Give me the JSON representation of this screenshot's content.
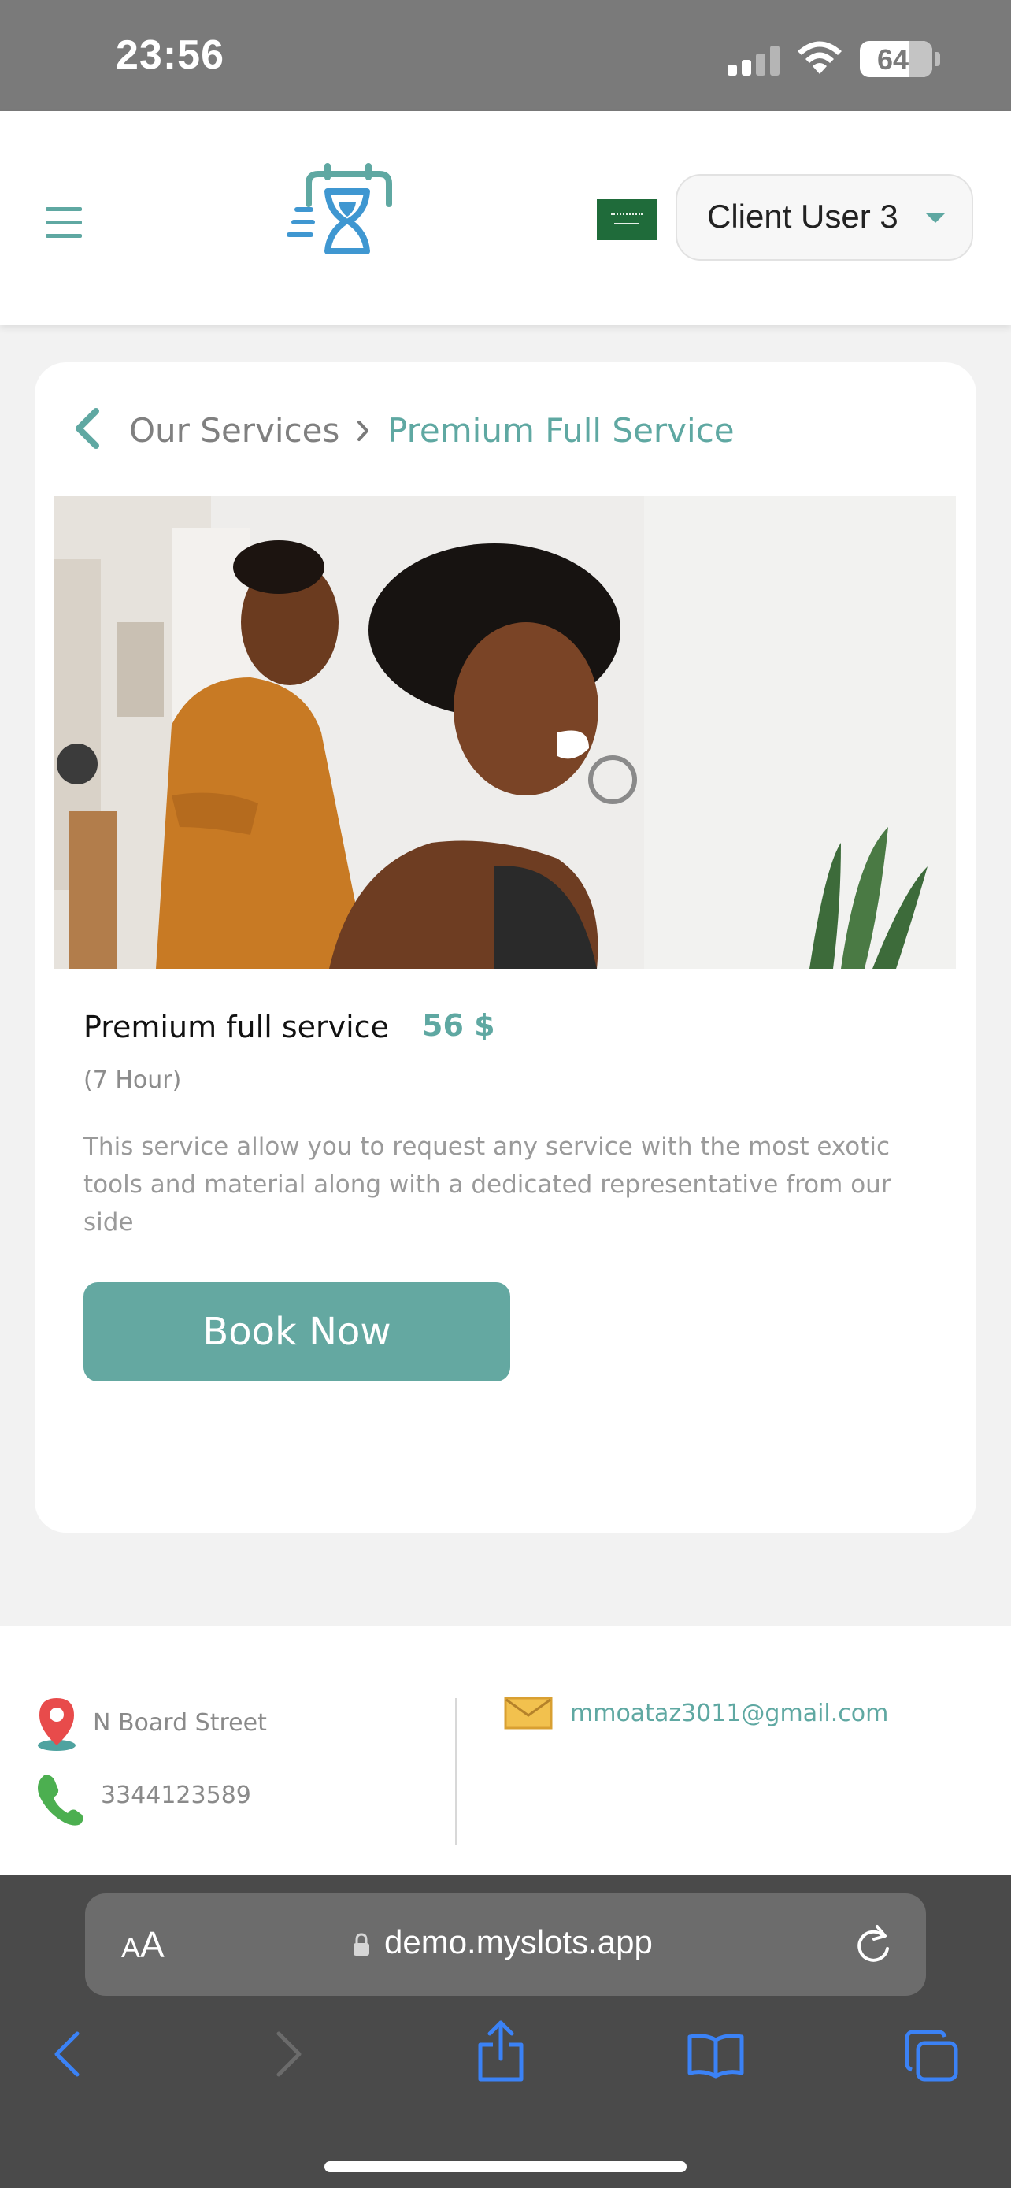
{
  "status_bar": {
    "time": "23:56",
    "battery": "64",
    "icons": [
      "signal-icon",
      "wifi-icon",
      "battery-icon"
    ]
  },
  "header": {
    "menu_icon": "hamburger-icon",
    "logo_icon": "calendar-hourglass-logo",
    "flag_icon": "saudi-flag-icon",
    "user_label": "Client User 3"
  },
  "breadcrumb": {
    "back_icon": "chevron-left-icon",
    "parent": "Our Services",
    "separator_icon": "chevron-right-icon",
    "current": "Premium Full Service"
  },
  "service": {
    "image": "stylist-doing-hair-photo",
    "title": "Premium full service",
    "price": "56 $",
    "duration": "(7 Hour)",
    "description": "This service allow you to request any service with the most exotic tools and material along with a dedicated representative from our side",
    "cta": "Book Now"
  },
  "footer": {
    "address": "N Board Street",
    "phone": "3344123589",
    "email": "mmoataz3011@gmail.com"
  },
  "browser": {
    "text_size_small": "A",
    "text_size_big": "A",
    "url": "demo.myslots.app",
    "toolbar_icons": [
      "back-arrow-icon",
      "forward-arrow-icon",
      "share-icon",
      "bookmarks-icon",
      "tabs-icon"
    ]
  },
  "colors": {
    "accent": "#5fa8a2",
    "button": "#64a8a1",
    "status_bar": "#7a7a7a",
    "browser_chrome": "#4a4a4a"
  }
}
